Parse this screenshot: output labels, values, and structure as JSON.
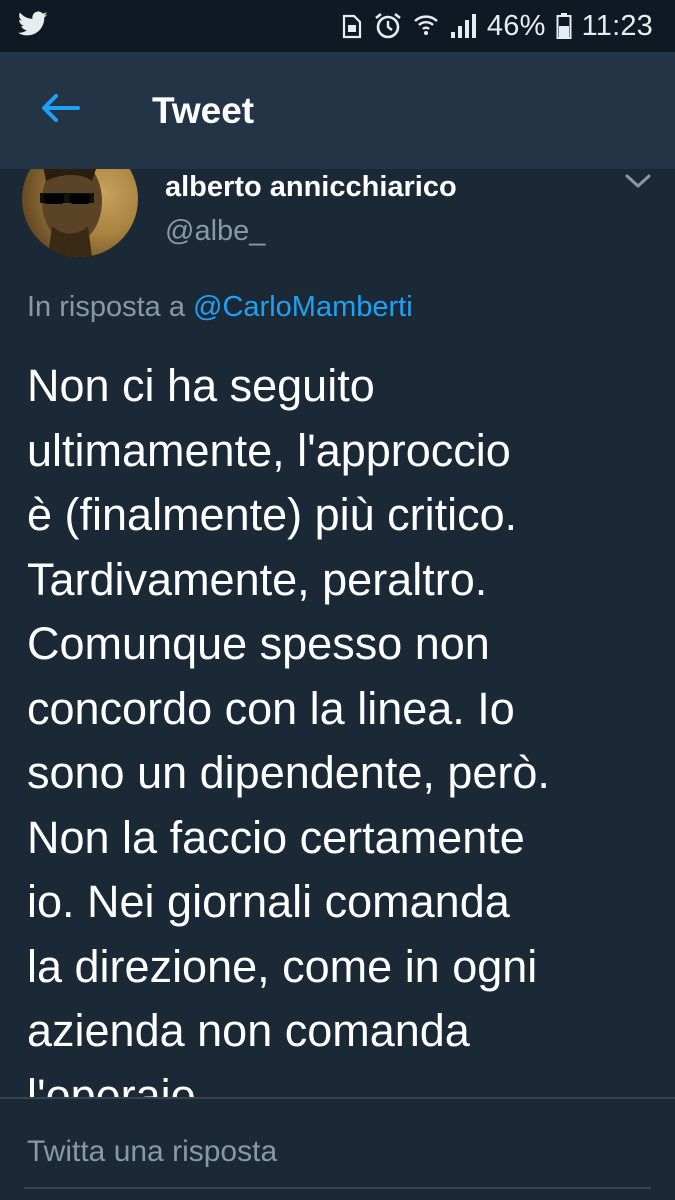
{
  "status_bar": {
    "battery_percent": "46%",
    "time": "11:23",
    "icons": [
      "twitter-bird-icon",
      "lock-save-icon",
      "alarm-icon",
      "wifi-icon",
      "signal-icon",
      "battery-icon"
    ]
  },
  "header": {
    "title": "Tweet",
    "back_icon": "back-arrow-icon",
    "accent_color": "#1da1f2"
  },
  "tweet": {
    "author_name": "alberto annicchiarico",
    "author_handle": "@albe_",
    "reply_prefix": "In risposta a",
    "reply_mention": "@CarloMamberti",
    "text": "Non ci ha seguito\nultimamente, l'approccio\nè (finalmente) più critico.\nTardivamente, peraltro.\nComunque spesso non\nconcordo con la linea. Io\nsono un dipendente, però.\nNon la faccio certamente\nio. Nei giornali comanda\nla direzione, come in ogni\nazienda non comanda\nl'operaio"
  },
  "composer": {
    "placeholder": "Twitta una risposta"
  },
  "colors": {
    "background": "#1b2836",
    "header_bg": "#243447",
    "status_bg": "#0f1924",
    "secondary_text": "#8899a6",
    "link": "#1da1f2"
  }
}
